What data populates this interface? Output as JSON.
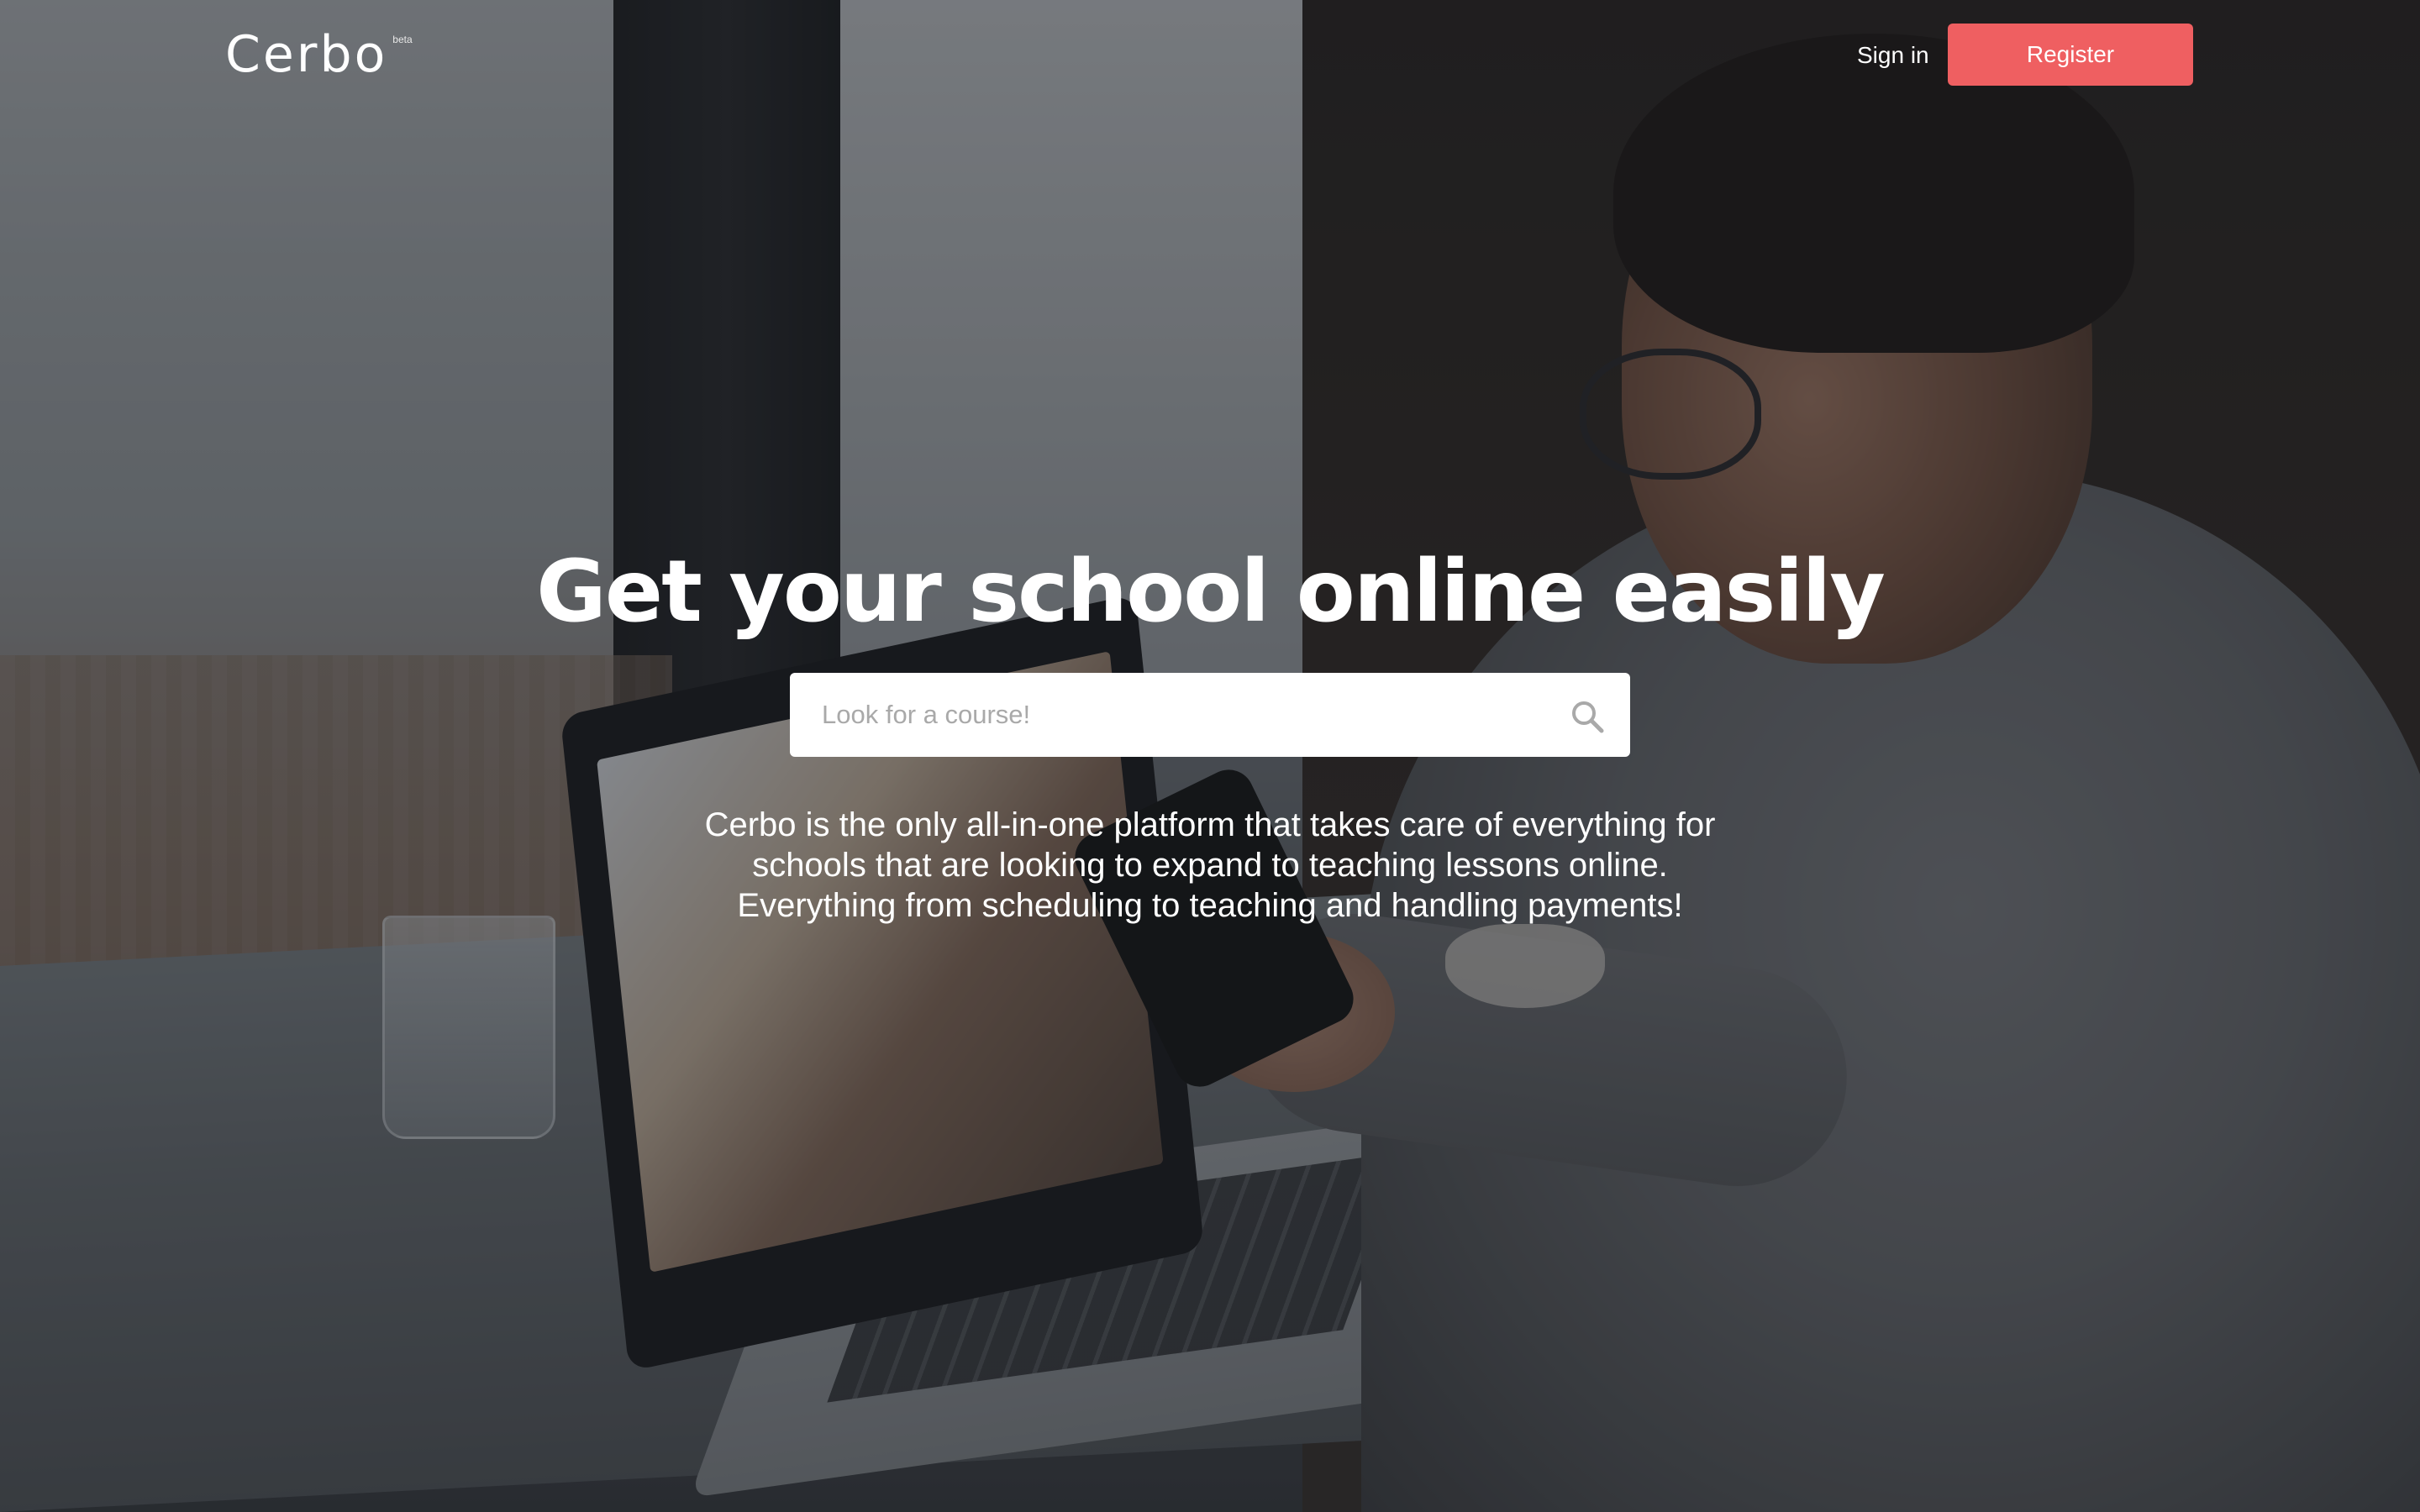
{
  "header": {
    "logo": "Cerbo",
    "logo_badge": "beta",
    "signin_label": "Sign in",
    "register_label": "Register"
  },
  "hero": {
    "headline": "Get your school online easily",
    "search": {
      "placeholder": "Look for a course!",
      "value": "",
      "icon": "search-icon"
    },
    "description_lines": [
      "Cerbo is the only all-in-one platform that takes care of everything for",
      "schools that are looking to expand to teaching lessons online.",
      "Everything from scheduling to teaching and handling payments!"
    ]
  },
  "colors": {
    "accent": "#ef5f61",
    "text": "#ffffff",
    "search_bg": "#ffffff",
    "placeholder": "#a9a9a9"
  }
}
